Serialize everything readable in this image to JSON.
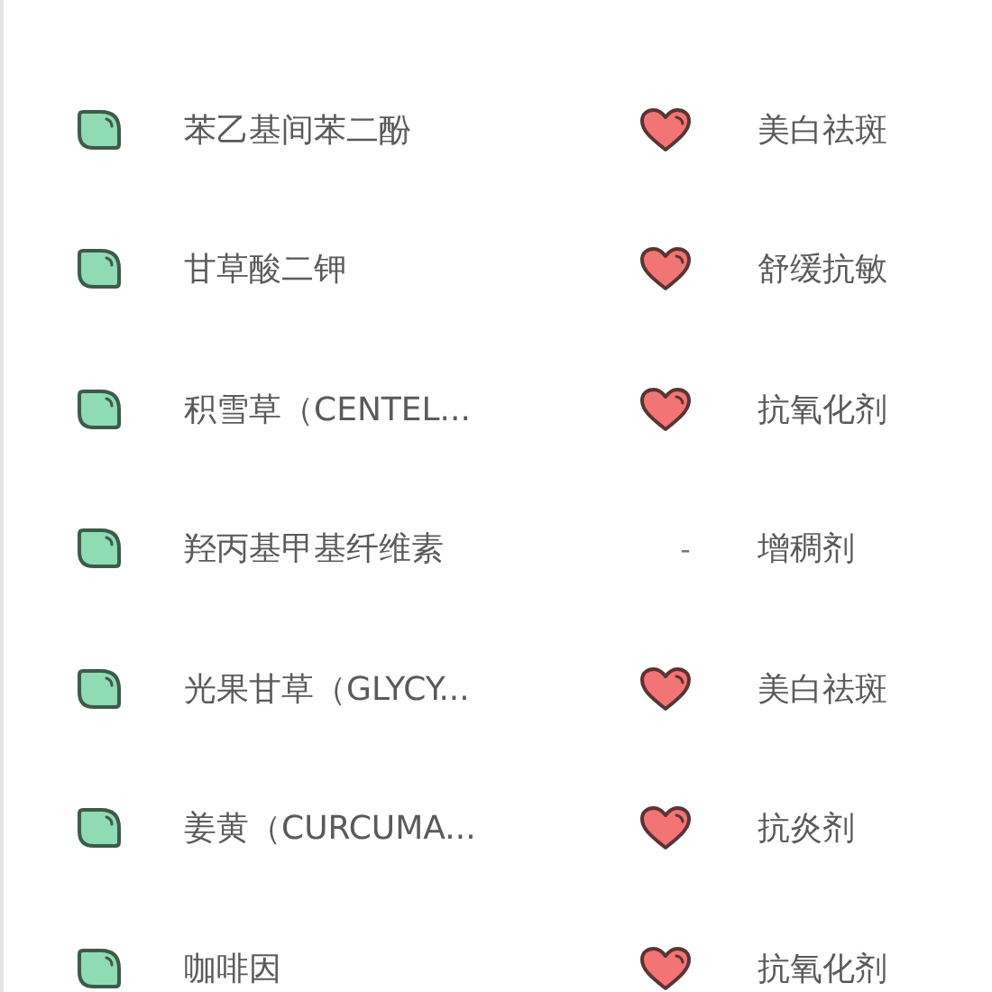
{
  "ingredients": [
    {
      "name": "苯乙基间苯二酚",
      "rating": {
        "kind": "heart"
      },
      "purpose": "美白祛斑"
    },
    {
      "name": "甘草酸二钾",
      "rating": {
        "kind": "heart"
      },
      "purpose": "舒缓抗敏"
    },
    {
      "name": "积雪草（CENTEL...",
      "rating": {
        "kind": "heart"
      },
      "purpose": "抗氧化剂"
    },
    {
      "name": "羟丙基甲基纤维素",
      "rating": {
        "kind": "text",
        "text": "-"
      },
      "purpose": "增稠剂"
    },
    {
      "name": "光果甘草（GLYCY...",
      "rating": {
        "kind": "heart"
      },
      "purpose": "美白祛斑"
    },
    {
      "name": "姜黄（CURCUMA...",
      "rating": {
        "kind": "heart"
      },
      "purpose": "抗炎剂"
    },
    {
      "name": "咖啡因",
      "rating": {
        "kind": "heart"
      },
      "purpose": "抗氧化剂"
    }
  ]
}
